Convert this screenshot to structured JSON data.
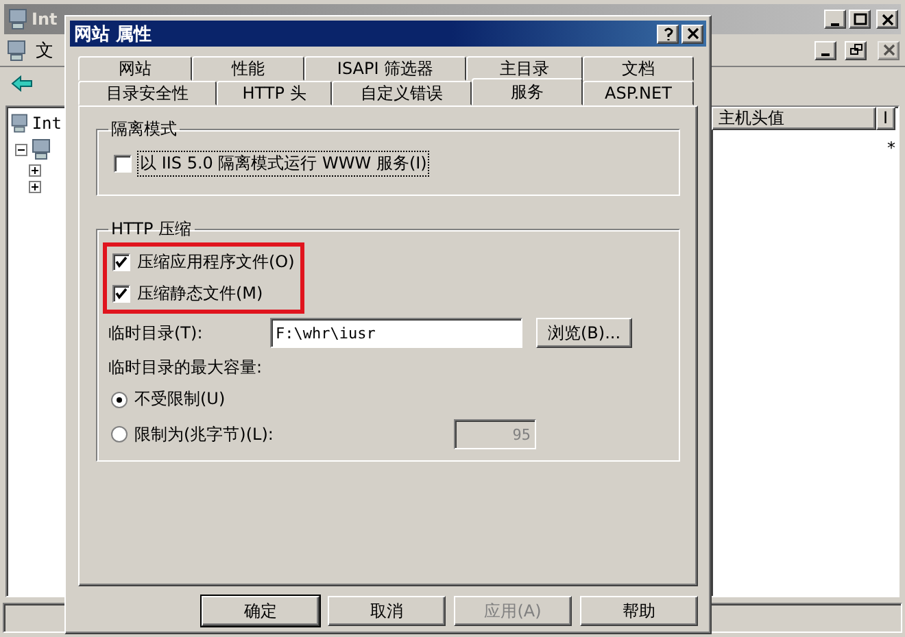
{
  "main_window": {
    "title": "Int",
    "menu": [
      "文"
    ],
    "tree": [
      {
        "label": "Int",
        "children": [
          {
            "expanded": true,
            "children": [
              {
                "expanded": false
              },
              {
                "expanded": false
              }
            ]
          }
        ]
      }
    ],
    "list_columns": [
      "主机头值",
      "I"
    ],
    "list_rows": [
      [
        "*"
      ]
    ]
  },
  "dialog": {
    "title": "网站 属性",
    "tab_rows": [
      [
        {
          "label": "网站",
          "selected": false
        },
        {
          "label": "性能",
          "selected": false
        },
        {
          "label": "ISAPI 筛选器",
          "selected": false
        },
        {
          "label": "主目录",
          "selected": false
        },
        {
          "label": "文档",
          "selected": false
        }
      ],
      [
        {
          "label": "目录安全性",
          "selected": false
        },
        {
          "label": "HTTP 头",
          "selected": false
        },
        {
          "label": "自定义错误",
          "selected": false
        },
        {
          "label": "服务",
          "selected": true
        },
        {
          "label": "ASP.NET",
          "selected": false
        }
      ]
    ],
    "isolation": {
      "title": "隔离模式",
      "option": {
        "label": "以 IIS 5.0 隔离模式运行 WWW 服务(I)",
        "checked": false
      }
    },
    "compression": {
      "title": "HTTP 压缩",
      "highlighted": true,
      "options": [
        {
          "label": "压缩应用程序文件(O)",
          "checked": true
        },
        {
          "label": "压缩静态文件(M)",
          "checked": true
        }
      ],
      "temp_dir": {
        "label": "临时目录(T):",
        "value": "F:\\whr\\iusr",
        "browse": "浏览(B)..."
      },
      "max_size_label": "临时目录的最大容量:",
      "limits": [
        {
          "label": "不受限制(U)",
          "selected": true
        },
        {
          "label": "限制为(兆字节)(L):",
          "selected": false
        }
      ],
      "limit_value": "95"
    },
    "buttons": [
      {
        "label": "确定",
        "default": true,
        "disabled": false
      },
      {
        "label": "取消",
        "default": false,
        "disabled": false
      },
      {
        "label": "应用(A)",
        "default": false,
        "disabled": true
      },
      {
        "label": "帮助",
        "default": false,
        "disabled": false
      }
    ]
  }
}
